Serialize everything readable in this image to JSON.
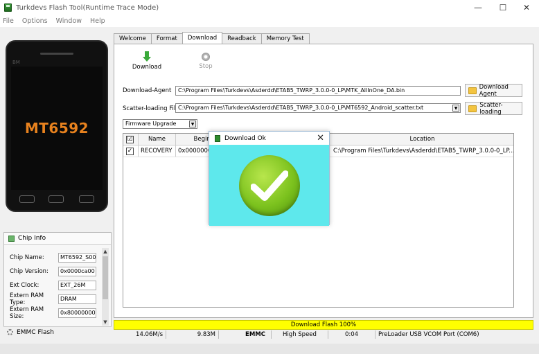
{
  "window": {
    "title": "Turkdevs Flash Tool(Runtime Trace Mode)"
  },
  "menu": [
    "File",
    "Options",
    "Window",
    "Help"
  ],
  "phone": {
    "brand": "BM",
    "chip_text": "MT6592"
  },
  "chip_info": {
    "header": "Chip Info",
    "rows": [
      {
        "label": "Chip Name:",
        "value": "MT6592_S00"
      },
      {
        "label": "Chip Version:",
        "value": "0x0000ca00"
      },
      {
        "label": "Ext Clock:",
        "value": "EXT_26M"
      },
      {
        "label": "Extern RAM Type:",
        "value": "DRAM"
      },
      {
        "label": "Extern RAM Size:",
        "value": "0x80000000"
      }
    ],
    "emmc_label": "EMMC Flash"
  },
  "tabs": [
    "Welcome",
    "Format",
    "Download",
    "Readback",
    "Memory Test"
  ],
  "toolbar": {
    "download_label": "Download",
    "stop_label": "Stop"
  },
  "form": {
    "download_agent_label": "Download-Agent",
    "download_agent_path": "C:\\Program Files\\Turkdevs\\Asderdd\\ETAB5_TWRP_3.0.0-0_LP\\MTK_AllInOne_DA.bin",
    "download_agent_button": "Download Agent",
    "scatter_label": "Scatter-loading File",
    "scatter_path": "C:\\Program Files\\Turkdevs\\Asderdd\\ETAB5_TWRP_3.0.0-0_LP\\MT6592_Android_scatter.txt",
    "scatter_button": "Scatter-loading",
    "mode_selected": "Firmware Upgrade"
  },
  "table": {
    "headers": {
      "check": "☑",
      "name": "Name",
      "begin": "Begin Ad",
      "location": "Location"
    },
    "rows": [
      {
        "checked": "✓",
        "name": "RECOVERY",
        "begin": "0x00000000",
        "location": "C:\\Program Files\\Turkdevs\\Asderdd\\ETAB5_TWRP_3.0.0-0_LP..."
      }
    ]
  },
  "dialog": {
    "title": "Download Ok",
    "close": "✕"
  },
  "status": {
    "progress_text": "Download Flash 100%",
    "progress": 1.0,
    "speed": "14.06M/s",
    "size": "9.83M",
    "storage": "EMMC",
    "usb_speed": "High Speed",
    "time": "0:04",
    "port": "PreLoader USB VCOM Port (COM6)"
  },
  "colors": {
    "progress_bar": "#ffff00",
    "dialog_body": "#5ee8ec",
    "ok_icon": "#7cc21e",
    "chip_text": "#e8821e"
  }
}
